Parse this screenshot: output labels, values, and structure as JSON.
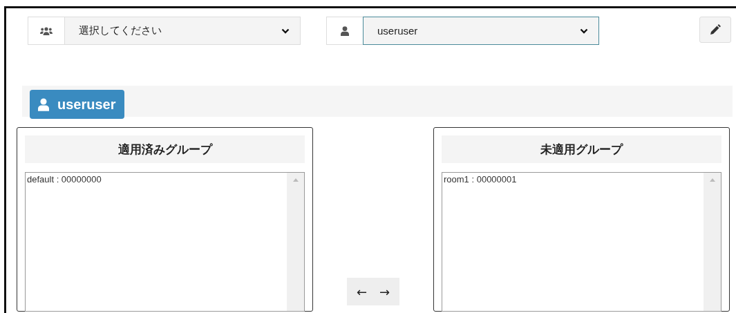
{
  "group_select": {
    "value": "選択してください"
  },
  "user_select": {
    "value": "useruser"
  },
  "user_badge": {
    "label": "useruser"
  },
  "panels": [
    {
      "title": "適用済みグループ",
      "items": [
        "default : 00000000"
      ]
    },
    {
      "title": "未適用グループ",
      "items": [
        "room1 : 00000001"
      ]
    }
  ],
  "move_buttons": [
    "←",
    "→"
  ]
}
